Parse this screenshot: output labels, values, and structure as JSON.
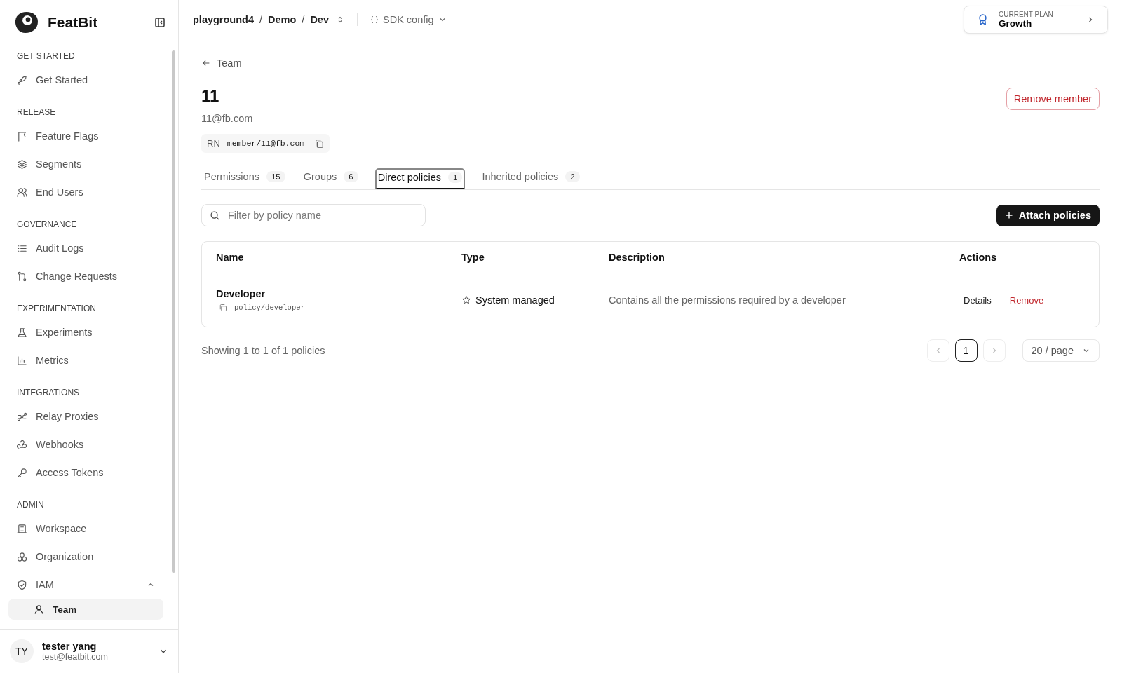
{
  "sidebar": {
    "brand": "FeatBit",
    "groups": [
      {
        "title": "GET STARTED",
        "items": [
          {
            "label": "Get Started"
          }
        ]
      },
      {
        "title": "RELEASE",
        "items": [
          {
            "label": "Feature Flags"
          },
          {
            "label": "Segments"
          },
          {
            "label": "End Users"
          }
        ]
      },
      {
        "title": "GOVERNANCE",
        "items": [
          {
            "label": "Audit Logs"
          },
          {
            "label": "Change Requests"
          }
        ]
      },
      {
        "title": "EXPERIMENTATION",
        "items": [
          {
            "label": "Experiments"
          },
          {
            "label": "Metrics"
          }
        ]
      },
      {
        "title": "INTEGRATIONS",
        "items": [
          {
            "label": "Relay Proxies"
          },
          {
            "label": "Webhooks"
          },
          {
            "label": "Access Tokens"
          }
        ]
      },
      {
        "title": "ADMIN",
        "items": [
          {
            "label": "Workspace"
          },
          {
            "label": "Organization"
          },
          {
            "label": "IAM",
            "expanded": true,
            "children": [
              {
                "label": "Team",
                "selected": true
              }
            ]
          }
        ]
      }
    ],
    "user": {
      "initials": "TY",
      "name": "tester yang",
      "email": "test@featbit.com"
    }
  },
  "header": {
    "breadcrumbs": [
      {
        "label": "playground4",
        "separator": "/"
      },
      {
        "label": "Demo",
        "separator": "/"
      },
      {
        "label": "Dev"
      }
    ],
    "sdk_config": "SDK config",
    "plan": {
      "caption": "CURRENT PLAN",
      "name": "Growth"
    }
  },
  "back_link": "Team",
  "member": {
    "name": "11",
    "email": "11@fb.com",
    "rn_label": "RN",
    "rn": "member/11@fb.com"
  },
  "remove_member": "Remove member",
  "tabs": [
    {
      "label": "Permissions",
      "count": "15",
      "selected": false
    },
    {
      "label": "Groups",
      "count": "6",
      "selected": false
    },
    {
      "label": "Direct policies",
      "count": "1",
      "selected": true
    },
    {
      "label": "Inherited policies",
      "count": "2",
      "selected": false
    }
  ],
  "search": {
    "placeholder": "Filter by policy name"
  },
  "attach_button": "Attach policies",
  "table": {
    "columns": [
      "Name",
      "Type",
      "Description",
      "Actions"
    ],
    "rows": [
      {
        "name": "Developer",
        "path": "policy/developer",
        "type": "System managed",
        "description": "Contains all the permissions required by a developer",
        "actions": [
          "Details",
          "Remove"
        ]
      }
    ]
  },
  "summary": "Showing 1 to 1 of 1 policies",
  "pagination": {
    "prev_disabled": true,
    "next_disabled": true,
    "pages": [
      {
        "label": "1",
        "selected": true
      }
    ],
    "page_size": "20 / page"
  }
}
